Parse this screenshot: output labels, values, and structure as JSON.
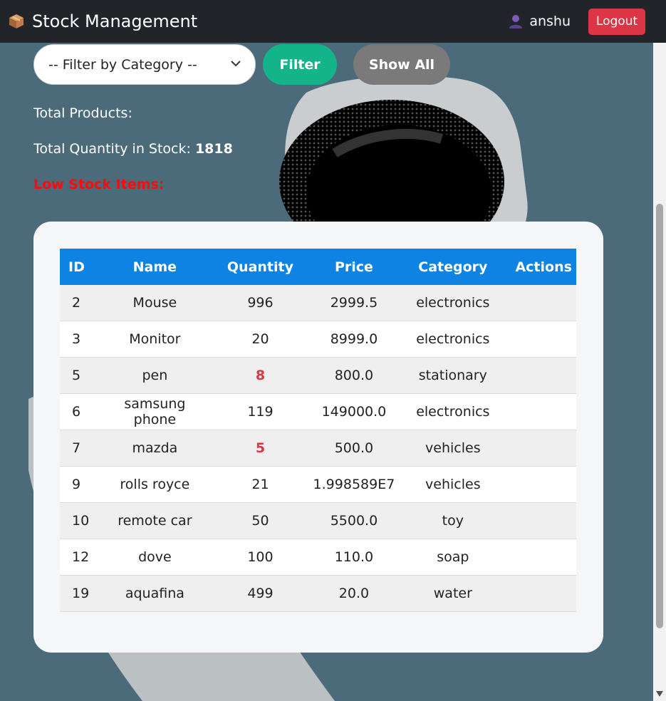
{
  "navbar": {
    "brand_icon": "package-icon",
    "title": "Stock Management",
    "user_icon": "user-icon",
    "username": "anshu",
    "logout_label": "Logout"
  },
  "filter": {
    "select_value": "-- Filter by Category --",
    "filter_label": "Filter",
    "show_all_label": "Show All"
  },
  "stats": {
    "total_products_label": "Total Products:",
    "total_quantity_label": "Total Quantity in Stock:",
    "total_quantity_value": "1818",
    "low_stock_label": "Low Stock Items:"
  },
  "table": {
    "headers": [
      "ID",
      "Name",
      "Quantity",
      "Price",
      "Category",
      "Actions"
    ],
    "rows": [
      {
        "id": "2",
        "name": "Mouse",
        "quantity": "996",
        "price": "2999.5",
        "category": "electronics",
        "low": false
      },
      {
        "id": "3",
        "name": "Monitor",
        "quantity": "20",
        "price": "8999.0",
        "category": "electronics",
        "low": false
      },
      {
        "id": "5",
        "name": "pen",
        "quantity": "8",
        "price": "800.0",
        "category": "stationary",
        "low": true
      },
      {
        "id": "6",
        "name": "samsung phone",
        "quantity": "119",
        "price": "149000.0",
        "category": "electronics",
        "low": false
      },
      {
        "id": "7",
        "name": "mazda",
        "quantity": "5",
        "price": "500.0",
        "category": "vehicles",
        "low": true
      },
      {
        "id": "9",
        "name": "rolls royce",
        "quantity": "21",
        "price": "1.998589E7",
        "category": "vehicles",
        "low": false
      },
      {
        "id": "10",
        "name": "remote car",
        "quantity": "50",
        "price": "5500.0",
        "category": "toy",
        "low": false
      },
      {
        "id": "12",
        "name": "dove",
        "quantity": "100",
        "price": "110.0",
        "category": "soap",
        "low": false
      },
      {
        "id": "19",
        "name": "aquafina",
        "quantity": "499",
        "price": "20.0",
        "category": "water",
        "low": false
      }
    ]
  },
  "colors": {
    "navbar_bg": "#212529",
    "logout_bg": "#dc3545",
    "filter_btn_bg": "#14b48b",
    "show_all_bg": "#7a7a7a",
    "table_header_bg": "#0d84e3",
    "low_stock_text": "#ff0a0a",
    "low_quantity_text": "#dc3545",
    "page_bg": "#4b6b7a"
  }
}
